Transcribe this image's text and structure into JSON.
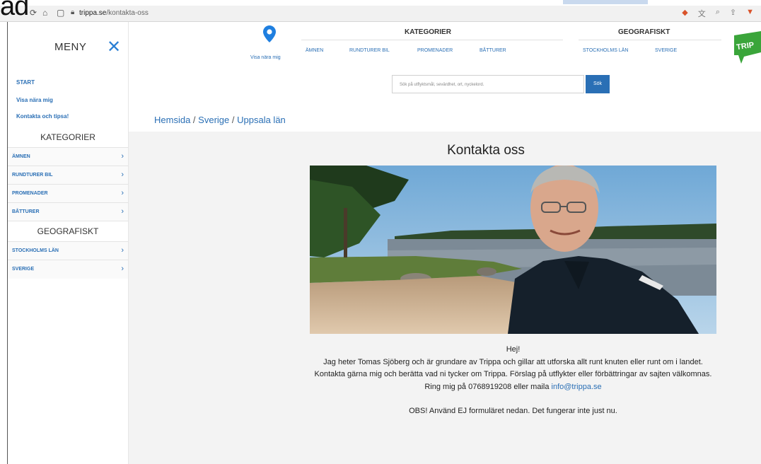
{
  "overlay": {
    "text": "ad"
  },
  "browser": {
    "url_domain": "trippa.se",
    "url_path": "/kontakta-oss"
  },
  "sidebar": {
    "title": "MENY",
    "links": [
      {
        "label": "START"
      },
      {
        "label": "Visa nära mig"
      },
      {
        "label": "Kontakta och tipsa!"
      }
    ],
    "categories_heading": "KATEGORIER",
    "categories": [
      {
        "label": "ÄMNEN"
      },
      {
        "label": "RUNDTURER BIL"
      },
      {
        "label": "PROMENADER"
      },
      {
        "label": "BÅTTURER"
      }
    ],
    "geo_heading": "GEOGRAFISKT",
    "geo": [
      {
        "label": "STOCKHOLMS LÄN"
      },
      {
        "label": "SVERIGE"
      }
    ]
  },
  "header": {
    "visa_nara": "Visa nära mig",
    "kategorier_heading": "KATEGORIER",
    "kategorier": [
      "ÄMNEN",
      "RUNDTURER BIL",
      "PROMENADER",
      "BÅTTURER"
    ],
    "geografiskt_heading": "GEOGRAFISKT",
    "geografiskt": [
      "STOCKHOLMS LÄN",
      "SVERIGE"
    ],
    "logo_text": "TRIP",
    "search_placeholder": "Sök på utflyktsmål, sevärdhet, ort, nyckelord.",
    "search_button": "Sök"
  },
  "breadcrumb": {
    "items": [
      "Hemsida",
      "Sverige",
      "Uppsala län"
    ],
    "separator": "/"
  },
  "main": {
    "title": "Kontakta oss",
    "greeting": "Hej!",
    "intro": "Jag heter Tomas Sjöberg och är grundare av Trippa och gillar att utforska allt runt knuten eller runt om i landet.",
    "invite": "Kontakta gärna mig och berätta vad ni tycker om Trippa. Förslag på utflykter eller förbättringar av sajten välkomnas.",
    "contact_prefix": "Ring mig på 0768919208 eller maila ",
    "email": "info@trippa.se",
    "notice": "OBS! Använd EJ formuläret nedan. Det fungerar inte just nu."
  },
  "colors": {
    "accent": "#2a6fb5",
    "close_icon": "#2a7fd4",
    "logo_green": "#3aa53a"
  }
}
